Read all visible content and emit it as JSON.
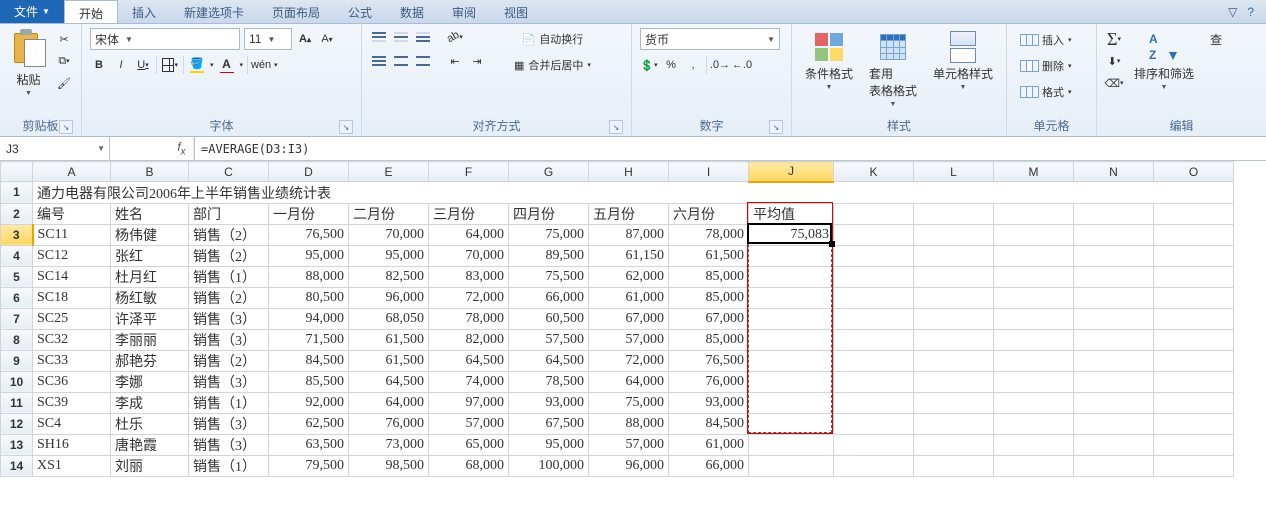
{
  "tabs": {
    "file": "文件",
    "items": [
      "开始",
      "插入",
      "新建选项卡",
      "页面布局",
      "公式",
      "数据",
      "审阅",
      "视图"
    ],
    "active": 0
  },
  "ribbon": {
    "clipboard": {
      "label": "剪贴板",
      "paste": "粘贴"
    },
    "font": {
      "label": "字体",
      "name": "宋体",
      "size": "11",
      "bold": "B",
      "italic": "I",
      "underline": "U"
    },
    "alignment": {
      "label": "对齐方式",
      "wrap": "自动换行",
      "merge": "合并后居中"
    },
    "number": {
      "label": "数字",
      "format": "货币"
    },
    "styles": {
      "label": "样式",
      "cond": "条件格式",
      "table": "套用\n表格格式",
      "cell": "单元格样式"
    },
    "cells": {
      "label": "单元格",
      "insert": "插入",
      "delete": "删除",
      "format": "格式"
    },
    "editing": {
      "label": "编辑",
      "sort": "排序和筛选",
      "find": "查"
    }
  },
  "namebox": "J3",
  "formula": "=AVERAGE(D3:I3)",
  "columns": [
    "A",
    "B",
    "C",
    "D",
    "E",
    "F",
    "G",
    "H",
    "I",
    "J",
    "K",
    "L",
    "M",
    "N",
    "O"
  ],
  "headerRow": [
    "编号",
    "姓名",
    "部门",
    "一月份",
    "二月份",
    "三月份",
    "四月份",
    "五月份",
    "六月份",
    "平均值"
  ],
  "titleRow": "通力电器有限公司2006年上半年销售业绩统计表",
  "rows": [
    {
      "n": 3,
      "c": [
        "SC11",
        "杨伟健",
        "销售（2）",
        "76,500",
        "70,000",
        "64,000",
        "75,000",
        "87,000",
        "78,000",
        "75,083"
      ]
    },
    {
      "n": 4,
      "c": [
        "SC12",
        "张红",
        "销售（2）",
        "95,000",
        "95,000",
        "70,000",
        "89,500",
        "61,150",
        "61,500",
        ""
      ]
    },
    {
      "n": 5,
      "c": [
        "SC14",
        "杜月红",
        "销售（1）",
        "88,000",
        "82,500",
        "83,000",
        "75,500",
        "62,000",
        "85,000",
        ""
      ]
    },
    {
      "n": 6,
      "c": [
        "SC18",
        "杨红敏",
        "销售（2）",
        "80,500",
        "96,000",
        "72,000",
        "66,000",
        "61,000",
        "85,000",
        ""
      ]
    },
    {
      "n": 7,
      "c": [
        "SC25",
        "许泽平",
        "销售（3）",
        "94,000",
        "68,050",
        "78,000",
        "60,500",
        "67,000",
        "67,000",
        ""
      ]
    },
    {
      "n": 8,
      "c": [
        "SC32",
        "李丽丽",
        "销售（3）",
        "71,500",
        "61,500",
        "82,000",
        "57,500",
        "57,000",
        "85,000",
        ""
      ]
    },
    {
      "n": 9,
      "c": [
        "SC33",
        "郝艳芬",
        "销售（2）",
        "84,500",
        "61,500",
        "64,500",
        "64,500",
        "72,000",
        "76,500",
        ""
      ]
    },
    {
      "n": 10,
      "c": [
        "SC36",
        "李娜",
        "销售（3）",
        "85,500",
        "64,500",
        "74,000",
        "78,500",
        "64,000",
        "76,000",
        ""
      ]
    },
    {
      "n": 11,
      "c": [
        "SC39",
        "李成",
        "销售（1）",
        "92,000",
        "64,000",
        "97,000",
        "93,000",
        "75,000",
        "93,000",
        ""
      ]
    },
    {
      "n": 12,
      "c": [
        "SC4",
        "杜乐",
        "销售（3）",
        "62,500",
        "76,000",
        "57,000",
        "67,500",
        "88,000",
        "84,500",
        ""
      ]
    },
    {
      "n": 13,
      "c": [
        "SH16",
        "唐艳霞",
        "销售（3）",
        "63,500",
        "73,000",
        "65,000",
        "95,000",
        "57,000",
        "61,000",
        ""
      ]
    },
    {
      "n": 14,
      "c": [
        "XS1",
        "刘丽",
        "销售（1）",
        "79,500",
        "98,500",
        "68,000",
        "100,000",
        "96,000",
        "66,000",
        ""
      ]
    }
  ],
  "chart_data": {
    "type": "table",
    "title": "通力电器有限公司2006年上半年销售业绩统计表",
    "columns": [
      "编号",
      "姓名",
      "部门",
      "一月份",
      "二月份",
      "三月份",
      "四月份",
      "五月份",
      "六月份",
      "平均值"
    ],
    "records": [
      [
        "SC11",
        "杨伟健",
        "销售（2）",
        76500,
        70000,
        64000,
        75000,
        87000,
        78000,
        75083
      ],
      [
        "SC12",
        "张红",
        "销售（2）",
        95000,
        95000,
        70000,
        89500,
        61150,
        61500,
        null
      ],
      [
        "SC14",
        "杜月红",
        "销售（1）",
        88000,
        82500,
        83000,
        75500,
        62000,
        85000,
        null
      ],
      [
        "SC18",
        "杨红敏",
        "销售（2）",
        80500,
        96000,
        72000,
        66000,
        61000,
        85000,
        null
      ],
      [
        "SC25",
        "许泽平",
        "销售（3）",
        94000,
        68050,
        78000,
        60500,
        67000,
        67000,
        null
      ],
      [
        "SC32",
        "李丽丽",
        "销售（3）",
        71500,
        61500,
        82000,
        57500,
        57000,
        85000,
        null
      ],
      [
        "SC33",
        "郝艳芬",
        "销售（2）",
        84500,
        61500,
        64500,
        64500,
        72000,
        76500,
        null
      ],
      [
        "SC36",
        "李娜",
        "销售（3）",
        85500,
        64500,
        74000,
        78500,
        64000,
        76000,
        null
      ],
      [
        "SC39",
        "李成",
        "销售（1）",
        92000,
        64000,
        97000,
        93000,
        75000,
        93000,
        null
      ],
      [
        "SC4",
        "杜乐",
        "销售（3）",
        62500,
        76000,
        57000,
        67500,
        88000,
        84500,
        null
      ],
      [
        "SH16",
        "唐艳霞",
        "销售（3）",
        63500,
        73000,
        65000,
        95000,
        57000,
        61000,
        null
      ],
      [
        "XS1",
        "刘丽",
        "销售（1）",
        79500,
        98500,
        68000,
        100000,
        96000,
        66000,
        null
      ]
    ]
  }
}
